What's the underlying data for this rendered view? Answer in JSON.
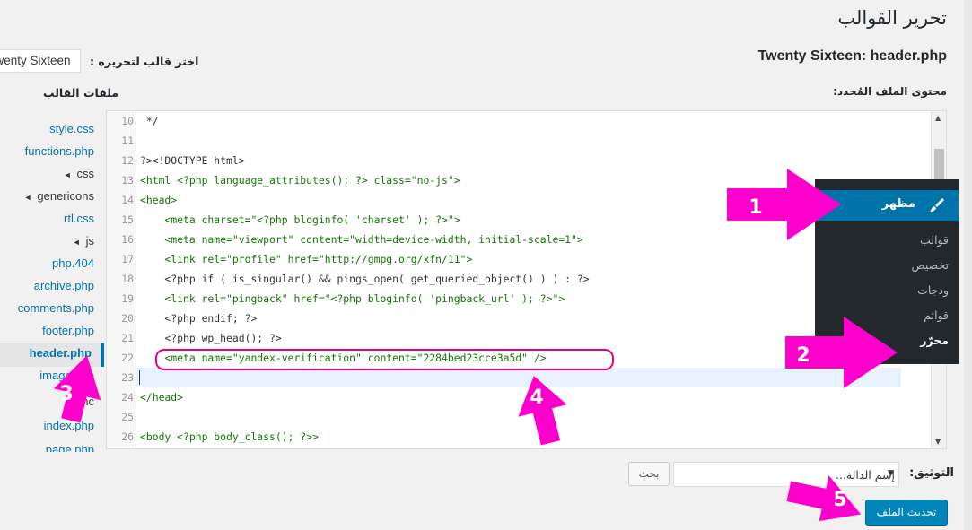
{
  "page": {
    "title": "تحرير القوالب",
    "file_heading": "Twenty Sixteen: header.php"
  },
  "theme_picker": {
    "label": "اختر قالب لتحريره :",
    "selected": "Twenty Sixteen"
  },
  "files": {
    "title": "ملفات القالب",
    "items": [
      {
        "label": "style.css",
        "type": "file"
      },
      {
        "label": "functions.php",
        "type": "file"
      },
      {
        "label": "css",
        "type": "dir"
      },
      {
        "label": "genericons",
        "type": "dir"
      },
      {
        "label": "rtl.css",
        "type": "file"
      },
      {
        "label": "js",
        "type": "dir"
      },
      {
        "label": "php.404",
        "type": "file"
      },
      {
        "label": "archive.php",
        "type": "file"
      },
      {
        "label": "comments.php",
        "type": "file"
      },
      {
        "label": "footer.php",
        "type": "file"
      },
      {
        "label": "header.php",
        "type": "file",
        "active": true
      },
      {
        "label": "image.php",
        "type": "file"
      },
      {
        "label": "inc",
        "type": "dir"
      },
      {
        "label": "index.php",
        "type": "file"
      },
      {
        "label": "page.php",
        "type": "file"
      }
    ]
  },
  "editor": {
    "label": "محتوى الملف المُحدد:",
    "lines": [
      {
        "n": "10",
        "text": " */"
      },
      {
        "n": "11",
        "text": ""
      },
      {
        "n": "12",
        "text": "?><!DOCTYPE html>"
      },
      {
        "n": "13",
        "text": "<html <?php language_attributes(); ?> class=\"no-js\">"
      },
      {
        "n": "14",
        "text": "<head>"
      },
      {
        "n": "15",
        "text": "    <meta charset=\"<?php bloginfo( 'charset' ); ?>\">"
      },
      {
        "n": "16",
        "text": "    <meta name=\"viewport\" content=\"width=device-width, initial-scale=1\">"
      },
      {
        "n": "17",
        "text": "    <link rel=\"profile\" href=\"http://gmpg.org/xfn/11\">"
      },
      {
        "n": "18",
        "text": "    <?php if ( is_singular() && pings_open( get_queried_object() ) ) : ?>"
      },
      {
        "n": "19",
        "text": "    <link rel=\"pingback\" href=\"<?php bloginfo( 'pingback_url' ); ?>\">"
      },
      {
        "n": "20",
        "text": "    <?php endif; ?>"
      },
      {
        "n": "21",
        "text": "    <?php wp_head(); ?>"
      },
      {
        "n": "22",
        "text": "    <meta name=\"yandex-verification\" content=\"2284bed23cce3a5d\" />"
      },
      {
        "n": "23",
        "text": ""
      },
      {
        "n": "24",
        "text": "</head>"
      },
      {
        "n": "25",
        "text": ""
      },
      {
        "n": "26",
        "text": "<body <?php body_class(); ?>>"
      }
    ]
  },
  "admin_menu": {
    "header": "مظهر",
    "items": [
      {
        "label": "قوالب"
      },
      {
        "label": "تخصيص"
      },
      {
        "label": "ودجات"
      },
      {
        "label": "قوائم"
      },
      {
        "label": "محرّر",
        "current": true
      }
    ]
  },
  "documentation": {
    "label": "التوثيق:",
    "select_placeholder": "إسم الدالة...",
    "lookup_label": "بحث"
  },
  "actions": {
    "update_label": "تحديث الملف"
  },
  "annotations": [
    "1",
    "2",
    "3",
    "4",
    "5"
  ],
  "colors": {
    "accent": "#0073aa",
    "annotation": "#ff00cc",
    "highlight": "#e6007e",
    "menu_bg": "#23282d"
  }
}
